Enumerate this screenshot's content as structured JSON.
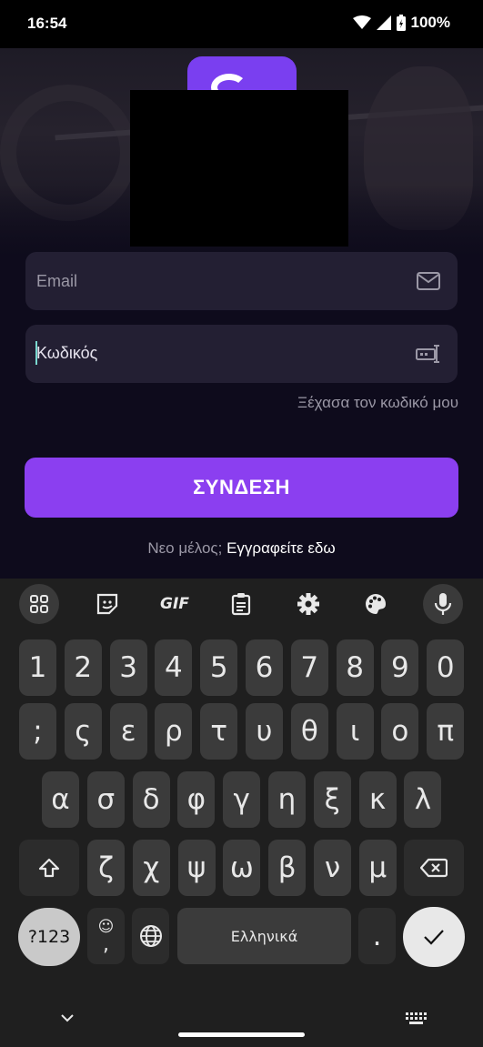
{
  "status": {
    "time": "16:54",
    "battery": "100%"
  },
  "login": {
    "email_placeholder": "Email",
    "password_value": "Κωδικός",
    "forgot_label": "Ξέχασα τον κωδικό μου",
    "submit_label": "ΣΥΝΔΕΣΗ",
    "new_member_prefix": "Νεο μέλος;",
    "signup_link": "Εγγραφείτε εδω"
  },
  "colors": {
    "accent": "#8b3ff0",
    "background": "#0e0b1c",
    "field": "#231f33"
  },
  "keyboard": {
    "toolbar": [
      "apps-icon",
      "sticker-icon",
      "GIF",
      "clipboard-icon",
      "gear-icon",
      "palette-icon",
      "mic-icon"
    ],
    "gif_label": "GIF",
    "row1": [
      "1",
      "2",
      "3",
      "4",
      "5",
      "6",
      "7",
      "8",
      "9",
      "0"
    ],
    "row2": [
      ";",
      "ς",
      "ε",
      "ρ",
      "τ",
      "υ",
      "θ",
      "ι",
      "ο",
      "π"
    ],
    "row3": [
      "α",
      "σ",
      "δ",
      "φ",
      "γ",
      "η",
      "ξ",
      "κ",
      "λ"
    ],
    "row4": [
      "ζ",
      "χ",
      "ψ",
      "ω",
      "β",
      "ν",
      "μ"
    ],
    "symbols_label": "?123",
    "emoji_top": "☺",
    "emoji_bottom": ",",
    "space_label": "Ελληνικά",
    "period_label": "."
  }
}
